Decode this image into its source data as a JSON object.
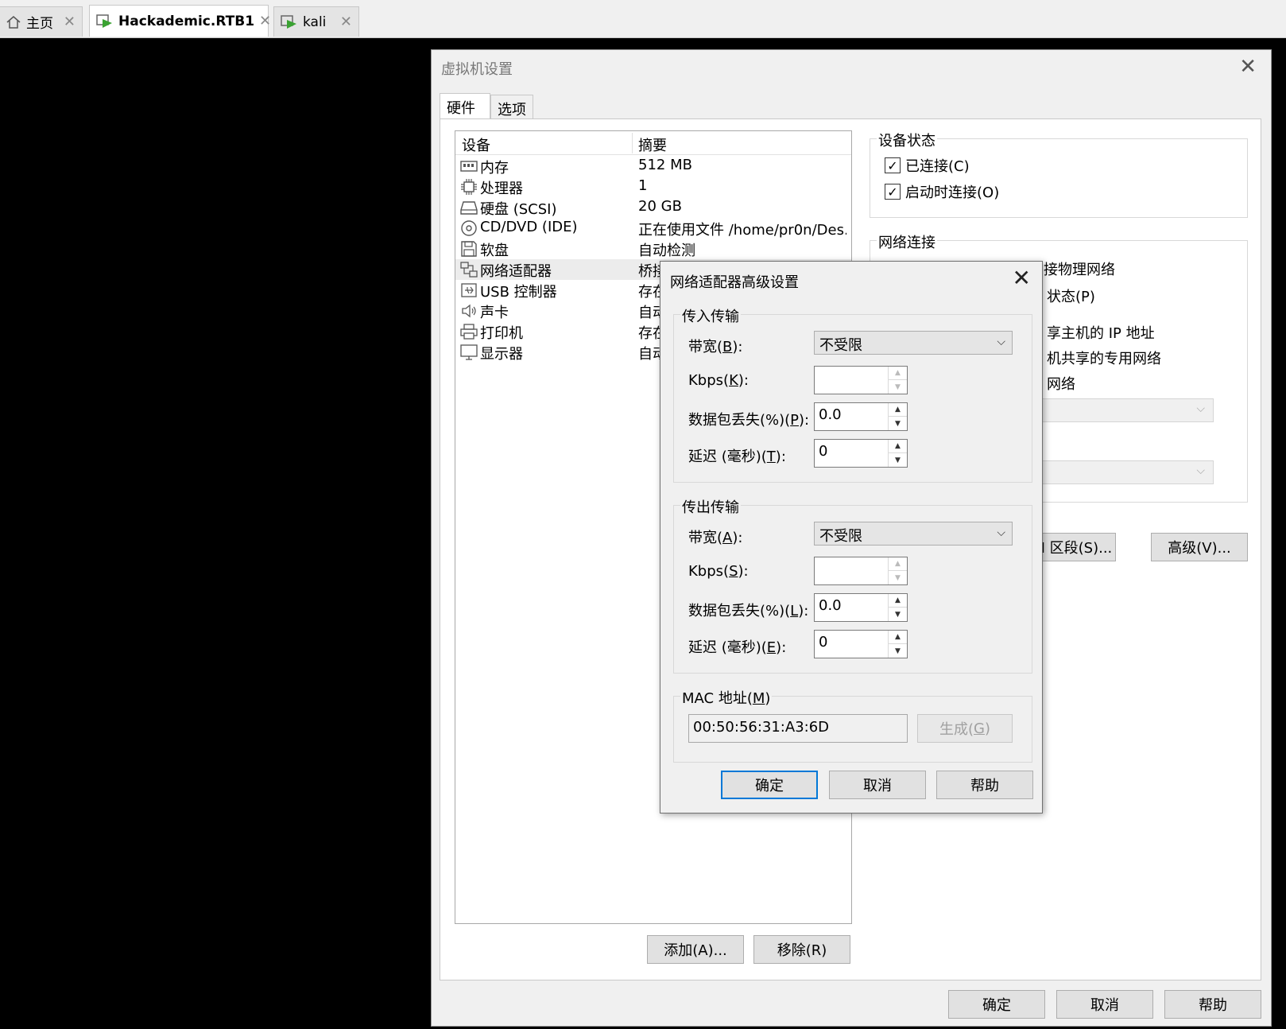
{
  "tabs": [
    {
      "label": "主页",
      "icon": "home-icon"
    },
    {
      "label": "Hackademic.RTB1",
      "icon": "vm-icon",
      "active": true
    },
    {
      "label": "kali",
      "icon": "vm-icon"
    }
  ],
  "vm_settings": {
    "title": "虚拟机设置",
    "tab_hardware": "硬件",
    "tab_options": "选项",
    "device_header": "设备",
    "summary_header": "摘要",
    "devices": [
      {
        "name": "内存",
        "summary": "512 MB",
        "icon": "memory-icon"
      },
      {
        "name": "处理器",
        "summary": "1",
        "icon": "cpu-icon"
      },
      {
        "name": "硬盘 (SCSI)",
        "summary": "20 GB",
        "icon": "harddisk-icon"
      },
      {
        "name": "CD/DVD (IDE)",
        "summary": "正在使用文件 /home/pr0n/Des...",
        "icon": "cdrom-icon"
      },
      {
        "name": "软盘",
        "summary": "自动检测",
        "icon": "floppy-icon"
      },
      {
        "name": "网络适配器",
        "summary": "桥接",
        "icon": "network-icon",
        "selected": true
      },
      {
        "name": "USB 控制器",
        "summary": "存在",
        "icon": "usb-icon"
      },
      {
        "name": "声卡",
        "summary": "自动",
        "icon": "sound-icon"
      },
      {
        "name": "打印机",
        "summary": "存在",
        "icon": "printer-icon"
      },
      {
        "name": "显示器",
        "summary": "自动",
        "icon": "display-icon"
      }
    ],
    "add_button": "添加(A)...",
    "remove_button": "移除(R)",
    "device_status": {
      "legend": "设备状态",
      "connected": "已连接(C)",
      "connect_at_poweron": "启动时连接(O)"
    },
    "network": {
      "legend": "网络连接",
      "line_physical": "接物理网络",
      "line_state": "状态(P)",
      "line_ip": "享主机的 IP 地址",
      "line_private": "机共享的专用网络",
      "line_custom": "网络"
    },
    "lan_segment_button": "LAN 区段(S)...",
    "advanced_button": "高级(V)...",
    "ok": "确定",
    "cancel": "取消",
    "help": "帮助"
  },
  "adv_dialog": {
    "title": "网络适配器高级设置",
    "incoming": {
      "legend": "传入传输",
      "bandwidth_label": "带宽(",
      "bandwidth_key": "B",
      "bandwidth_value": "不受限",
      "kbps_label": "Kbps(",
      "kbps_key": "K",
      "kbps_value": "",
      "loss_label": "数据包丢失(%)(",
      "loss_key": "P",
      "loss_value": "0.0",
      "latency_label": "延迟 (毫秒)(",
      "latency_key": "T",
      "latency_value": "0"
    },
    "outgoing": {
      "legend": "传出传输",
      "bandwidth_label": "带宽(",
      "bandwidth_key": "A",
      "bandwidth_value": "不受限",
      "kbps_label": "Kbps(",
      "kbps_key": "S",
      "kbps_value": "",
      "loss_label": "数据包丢失(%)(",
      "loss_key": "L",
      "loss_value": "0.0",
      "latency_label": "延迟 (毫秒)(",
      "latency_key": "E",
      "latency_value": "0"
    },
    "label_close": "):",
    "mac": {
      "legend_prefix": "MAC 地址(",
      "legend_key": "M",
      "legend_suffix": ")",
      "value": "00:50:56:31:A3:6D",
      "generate_prefix": "生成(",
      "generate_key": "G",
      "generate_suffix": ")"
    },
    "ok": "确定",
    "cancel": "取消",
    "help": "帮助"
  }
}
